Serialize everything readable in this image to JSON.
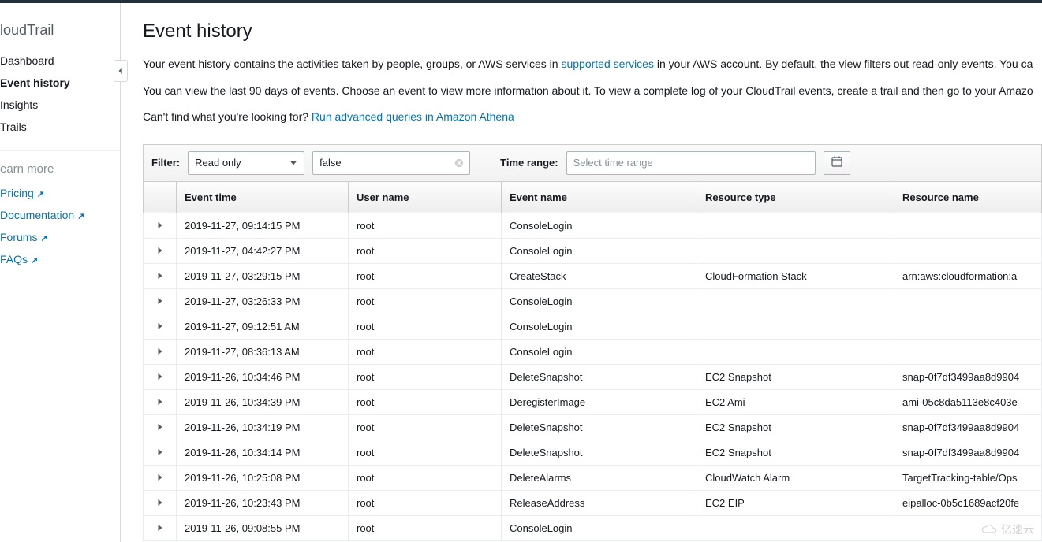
{
  "sidebar": {
    "title": "loudTrail",
    "nav": [
      {
        "label": "Dashboard"
      },
      {
        "label": "Event history"
      },
      {
        "label": "Insights"
      },
      {
        "label": "Trails"
      }
    ],
    "learn_more_label": "earn more",
    "links": [
      {
        "label": "Pricing"
      },
      {
        "label": "Documentation"
      },
      {
        "label": "Forums"
      },
      {
        "label": "FAQs"
      }
    ]
  },
  "header": {
    "title": "Event history"
  },
  "intro": {
    "p1_a": "Your event history contains the activities taken by people, groups, or AWS services in ",
    "p1_link": "supported services",
    "p1_b": " in your AWS account. By default, the view filters out read-only events. You ca",
    "p2": "You can view the last 90 days of events. Choose an event to view more information about it. To view a complete log of your CloudTrail events, create a trail and then go to your Amazo",
    "p3_a": "Can't find what you're looking for? ",
    "p3_link": "Run advanced queries in Amazon Athena"
  },
  "filter": {
    "label": "Filter:",
    "attribute": "Read only",
    "value": "false",
    "time_range_label": "Time range:",
    "time_range_placeholder": "Select time range"
  },
  "table": {
    "columns": [
      "",
      "Event time",
      "User name",
      "Event name",
      "Resource type",
      "Resource name"
    ],
    "rows": [
      {
        "time": "2019-11-27, 09:14:15 PM",
        "user": "root",
        "event": "ConsoleLogin",
        "rtype": "",
        "rname": ""
      },
      {
        "time": "2019-11-27, 04:42:27 PM",
        "user": "root",
        "event": "ConsoleLogin",
        "rtype": "",
        "rname": ""
      },
      {
        "time": "2019-11-27, 03:29:15 PM",
        "user": "root",
        "event": "CreateStack",
        "rtype": "CloudFormation Stack",
        "rname": "arn:aws:cloudformation:a"
      },
      {
        "time": "2019-11-27, 03:26:33 PM",
        "user": "root",
        "event": "ConsoleLogin",
        "rtype": "",
        "rname": ""
      },
      {
        "time": "2019-11-27, 09:12:51 AM",
        "user": "root",
        "event": "ConsoleLogin",
        "rtype": "",
        "rname": ""
      },
      {
        "time": "2019-11-27, 08:36:13 AM",
        "user": "root",
        "event": "ConsoleLogin",
        "rtype": "",
        "rname": ""
      },
      {
        "time": "2019-11-26, 10:34:46 PM",
        "user": "root",
        "event": "DeleteSnapshot",
        "rtype": "EC2 Snapshot",
        "rname": "snap-0f7df3499aa8d9904"
      },
      {
        "time": "2019-11-26, 10:34:39 PM",
        "user": "root",
        "event": "DeregisterImage",
        "rtype": "EC2 Ami",
        "rname": "ami-05c8da5113e8c403e"
      },
      {
        "time": "2019-11-26, 10:34:19 PM",
        "user": "root",
        "event": "DeleteSnapshot",
        "rtype": "EC2 Snapshot",
        "rname": "snap-0f7df3499aa8d9904"
      },
      {
        "time": "2019-11-26, 10:34:14 PM",
        "user": "root",
        "event": "DeleteSnapshot",
        "rtype": "EC2 Snapshot",
        "rname": "snap-0f7df3499aa8d9904"
      },
      {
        "time": "2019-11-26, 10:25:08 PM",
        "user": "root",
        "event": "DeleteAlarms",
        "rtype": "CloudWatch Alarm",
        "rname": "TargetTracking-table/Ops"
      },
      {
        "time": "2019-11-26, 10:23:43 PM",
        "user": "root",
        "event": "ReleaseAddress",
        "rtype": "EC2 EIP",
        "rname": "eipalloc-0b5c1689acf20fe"
      },
      {
        "time": "2019-11-26, 09:08:55 PM",
        "user": "root",
        "event": "ConsoleLogin",
        "rtype": "",
        "rname": ""
      }
    ]
  },
  "watermark": "亿速云"
}
